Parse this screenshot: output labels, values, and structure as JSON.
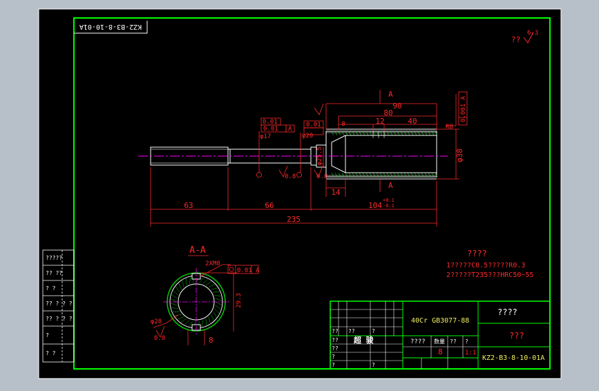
{
  "header": {
    "drawing_number_mirrored": "KZ2-B3-8-10-01A",
    "roughness_note": "??",
    "roughness_value": "6.3"
  },
  "drawing": {
    "section_label": "A-A",
    "section_marker": "A",
    "dims": {
      "d90": "90",
      "d80": "80",
      "d40": "40",
      "d12": "12",
      "d8": "8",
      "d63": "63",
      "d66": "66",
      "d104": "104",
      "d104_tol_upper": "+0.1",
      "d104_tol_lower": "-0.1",
      "d235": "235",
      "d14": "14",
      "d38": "φ38",
      "d25_5": "φ25.5",
      "d17": "φ17",
      "d20": "φ20",
      "d29_3": "29.3",
      "d28": "φ28",
      "d2xm8": "2XM8",
      "d8_key": "8",
      "roughness_08": "0.8",
      "r8": "R8",
      "tol_001": "0.01",
      "tol_001_A": "0.01 A",
      "tol_0001_A": "0.001 A",
      "gdt_A": "A"
    },
    "notes": {
      "title": "????",
      "line1": "1?????C0.5?????R0.3",
      "line2": "2?????T235???HRC50~55"
    }
  },
  "left_strip": {
    "cells": [
      "?????",
      "?? ??",
      "? ?",
      "?? ? ? ?",
      "?? ? ? ?",
      "?",
      "? ?"
    ]
  },
  "title_block": {
    "material": "40Cr  GB3077-88",
    "part_name": "????",
    "name_sub": "???",
    "company": "超 骏",
    "scale_label": "????",
    "qty_label": "数量",
    "qty_value": "8",
    "scale_value": "1:1",
    "drawing_number": "KZ2-B3-8-10-01A",
    "small_cells": [
      "??",
      "??",
      "?",
      "??",
      "??",
      "?",
      "?",
      "?",
      "??",
      "?"
    ]
  }
}
